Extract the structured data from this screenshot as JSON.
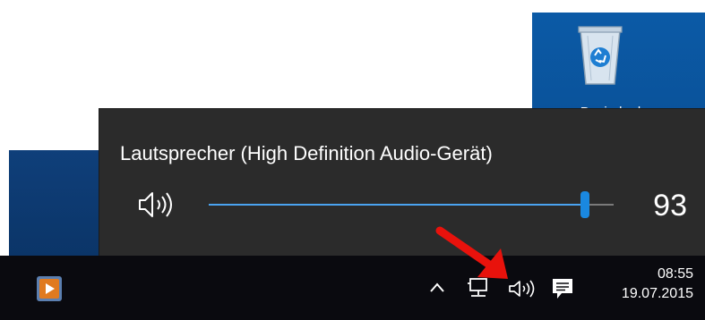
{
  "desktop": {
    "recycle_bin_label": "Papierkorb",
    "recycle_bin_icon": "recycle-bin-icon"
  },
  "flyout": {
    "device_name": "Lautsprecher (High Definition Audio-Gerät)",
    "volume_value": "93",
    "volume_level": 0.93,
    "speaker_icon": "speaker-icon",
    "accent_color": "#1a88e0"
  },
  "taskbar": {
    "app_icon": "media-player-icon",
    "tray": {
      "chevron_icon": "chevron-up-icon",
      "network_icon": "network-icon",
      "volume_icon": "volume-icon",
      "notifications_icon": "action-center-icon"
    },
    "clock": {
      "time": "08:55",
      "date": "19.07.2015"
    }
  },
  "annotation": {
    "arrow_color": "#e8120c",
    "arrow_icon": "red-arrow"
  }
}
